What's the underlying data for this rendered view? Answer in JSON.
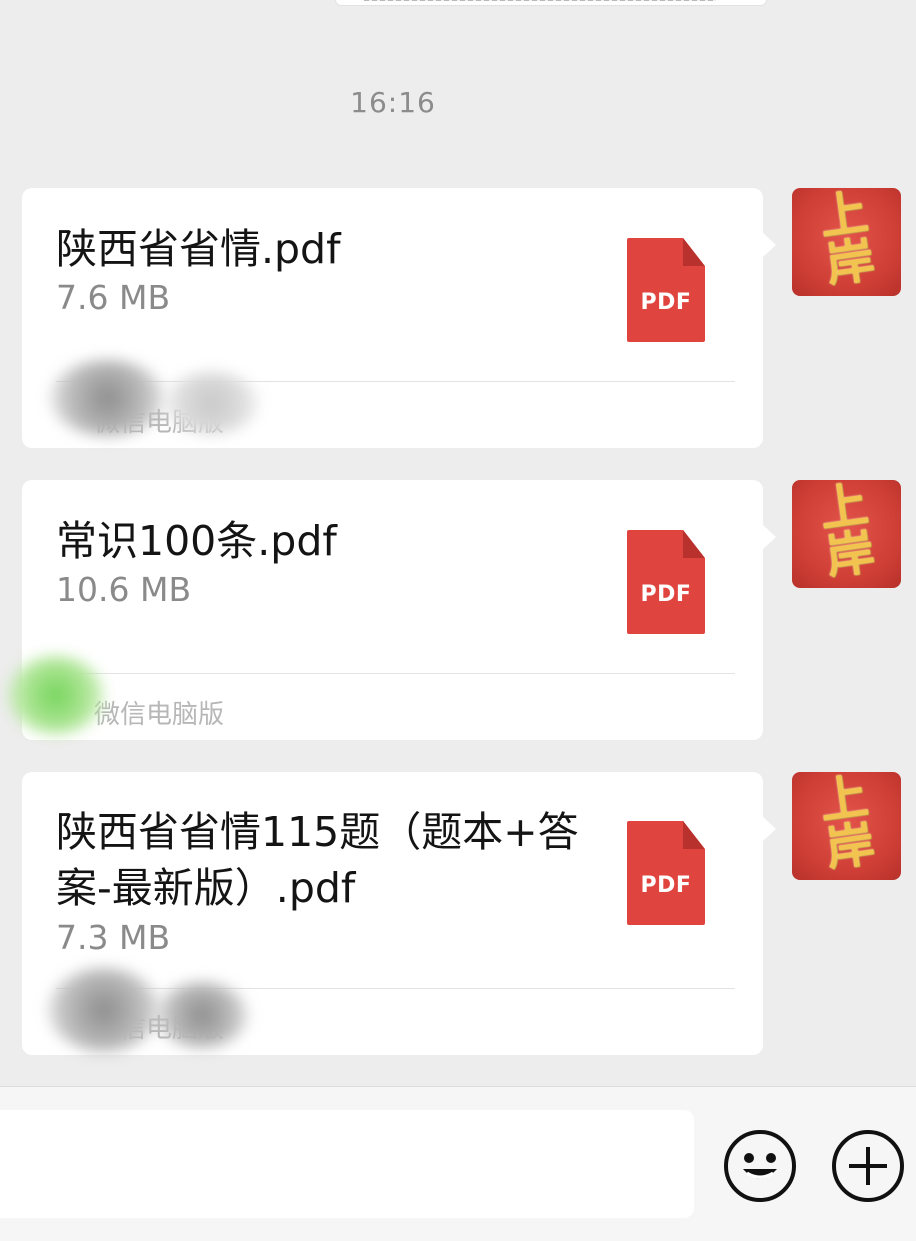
{
  "chat": {
    "timestamp": "16:16",
    "messages": [
      {
        "file_name": "陕西省省情.pdf",
        "file_size": "7.6 MB",
        "file_icon": "pdf-file-icon",
        "file_icon_label": "PDF",
        "source": "微信电脑版",
        "sender_avatar_text": "上岸"
      },
      {
        "file_name": "常识100条.pdf",
        "file_size": "10.6 MB",
        "file_icon": "pdf-file-icon",
        "file_icon_label": "PDF",
        "source": "微信电脑版",
        "sender_avatar_text": "上岸"
      },
      {
        "file_name": "陕西省省情115题（题本+答案-最新版）.pdf",
        "file_size": "7.3 MB",
        "file_icon": "pdf-file-icon",
        "file_icon_label": "PDF",
        "source": "微信电脑版",
        "sender_avatar_text": "上岸"
      }
    ]
  },
  "input_bar": {
    "emoji_icon": "smile-face-icon",
    "more_icon": "plus-circle-icon"
  },
  "colors": {
    "background": "#ededed",
    "bubble": "#ffffff",
    "pdf_icon": "#e0443e",
    "avatar": "#d23d35",
    "avatar_text": "#f2c44f"
  }
}
